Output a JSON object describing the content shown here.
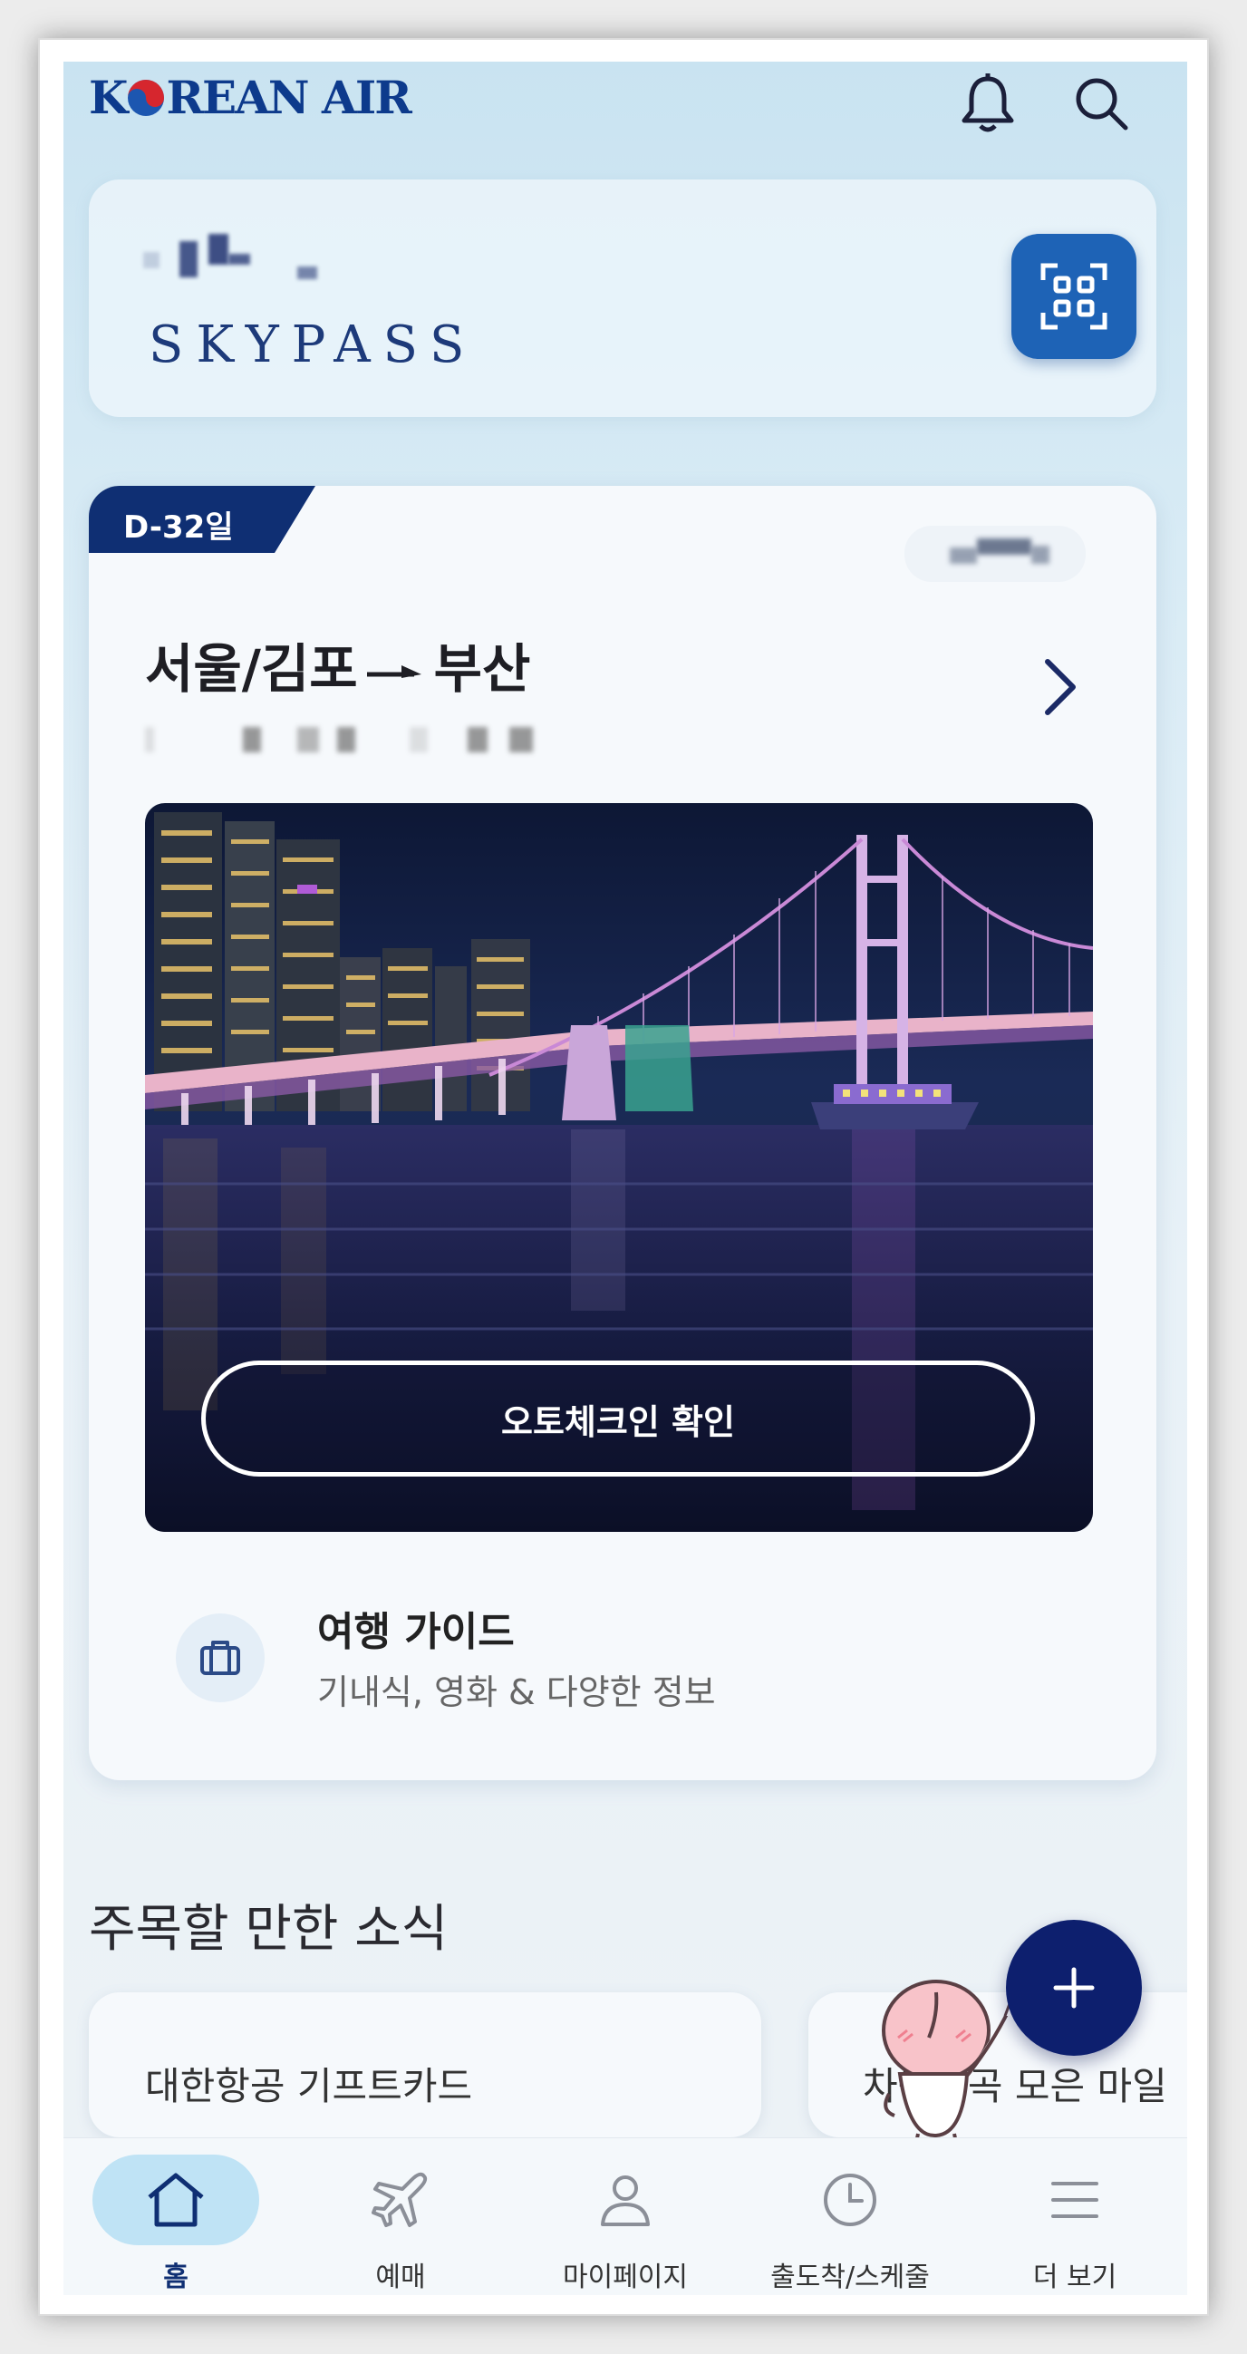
{
  "header": {
    "logo_text_left": "K",
    "logo_text_right": "REAN AIR",
    "bell_icon": "bell-icon",
    "search_icon": "search-icon"
  },
  "skypass": {
    "brand": "SKYPASS",
    "qr_icon": "qr-scan-icon"
  },
  "trip": {
    "dday": "D-32일",
    "origin": "서울/김포",
    "destination": "부산",
    "checkin_label": "오토체크인 확인",
    "guide_title": "여행 가이드",
    "guide_subtitle": "기내식, 영화 & 다양한 정보"
  },
  "news": {
    "section_title": "주목할 만한 소식",
    "cards": [
      {
        "title": "대한항공 기프트카드"
      },
      {
        "title": "차곡차곡 모은 마일"
      }
    ]
  },
  "fab_icon": "plus-icon",
  "bottom_nav": {
    "items": [
      {
        "label": "홈",
        "icon": "home-icon",
        "active": true
      },
      {
        "label": "예매",
        "icon": "airplane-icon",
        "active": false
      },
      {
        "label": "마이페이지",
        "icon": "person-icon",
        "active": false
      },
      {
        "label": "출도착/스케줄",
        "icon": "clock-icon",
        "active": false
      },
      {
        "label": "더 보기",
        "icon": "menu-icon",
        "active": false
      }
    ]
  },
  "colors": {
    "brand_navy": "#0f2f73",
    "qr_blue": "#1e63b6",
    "fab_navy": "#0d1f6e",
    "nav_active_bg": "#bfe3f5"
  }
}
